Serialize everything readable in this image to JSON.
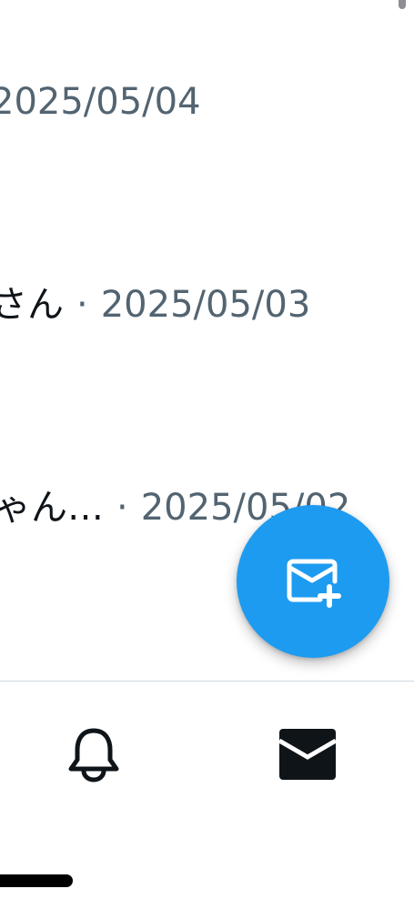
{
  "messages": [
    {
      "sender": "",
      "date": "2025/05/04"
    },
    {
      "sender": "さん",
      "date": "2025/05/03"
    },
    {
      "sender": "ゃん…",
      "date": "2025/05/02"
    }
  ],
  "separator": "·",
  "icons": {
    "compose": "compose-message-icon",
    "notifications": "bell-icon",
    "messages": "envelope-icon"
  },
  "colors": {
    "accent": "#1d9bf0",
    "secondary_text": "#536471",
    "primary_text": "#0f1419",
    "divider": "#cfd9de"
  }
}
